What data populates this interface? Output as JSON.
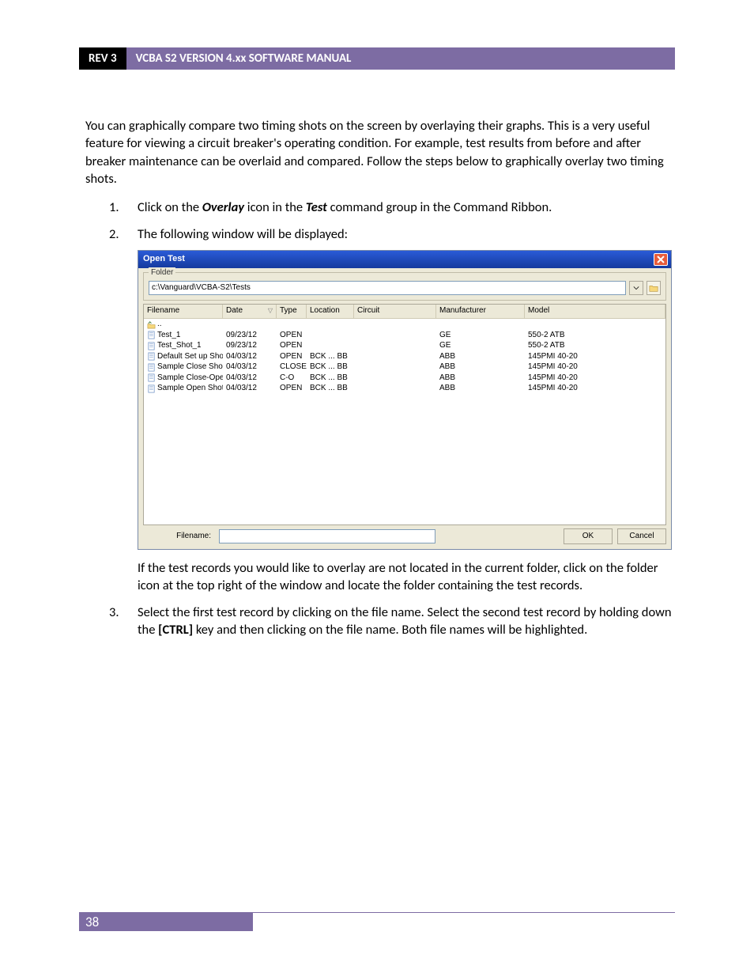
{
  "header": {
    "rev": "REV 3",
    "title": "VCBA S2 VERSION 4.xx SOFTWARE MANUAL"
  },
  "intro": "You can graphically compare two timing shots on the screen by overlaying their graphs. This is a very useful feature for viewing a circuit breaker's operating condition. For example, test results from before and after breaker maintenance can be overlaid and compared. Follow the steps below to graphically overlay two timing shots.",
  "steps": {
    "s1": {
      "num": "1.",
      "pre": "Click on the ",
      "overlay": "Overlay",
      "mid": " icon in the ",
      "test": "Test",
      "post": " command group in the Command Ribbon."
    },
    "s2": {
      "num": "2.",
      "text": "The following window will be displayed:",
      "after": "If the test records you would like to overlay are not located in the current folder, click on the folder icon at the top right of the window and locate the folder containing the test records."
    },
    "s3": {
      "num": "3.",
      "pre": "Select the first test record by clicking on the file name. Select the second test record by holding down the ",
      "ctrl": "[CTRL]",
      "post": " key and then clicking on the file name. Both file names will be highlighted."
    }
  },
  "dialog": {
    "title": "Open Test",
    "folder_label": "Folder",
    "folder_path": "c:\\Vanguard\\VCBA-S2\\Tests",
    "columns": {
      "file": "Filename",
      "date": "Date",
      "type": "Type",
      "location": "Location",
      "circuit": "Circuit",
      "mfr": "Manufacturer",
      "model": "Model"
    },
    "up": "..",
    "rows": [
      {
        "file": "Test_1",
        "date": "09/23/12",
        "type": "OPEN",
        "loc": "",
        "circ": "",
        "mfr": "GE",
        "model": "550-2 ATB"
      },
      {
        "file": "Test_Shot_1",
        "date": "09/23/12",
        "type": "OPEN",
        "loc": "",
        "circ": "",
        "mfr": "GE",
        "model": "550-2 ATB"
      },
      {
        "file": "Default Set up Shot",
        "date": "04/03/12",
        "type": "OPEN",
        "loc": "BCK     ...   BB",
        "circ": "",
        "mfr": "ABB",
        "model": "145PMI 40-20"
      },
      {
        "file": "Sample Close Shot",
        "date": "04/03/12",
        "type": "CLOSE",
        "loc": "BCK     ...   BB",
        "circ": "",
        "mfr": "ABB",
        "model": "145PMI 40-20"
      },
      {
        "file": "Sample Close-Open Shot",
        "date": "04/03/12",
        "type": "C-O",
        "loc": "BCK     ...   BB",
        "circ": "",
        "mfr": "ABB",
        "model": "145PMI 40-20"
      },
      {
        "file": "Sample Open Shot",
        "date": "04/03/12",
        "type": "OPEN",
        "loc": "BCK     ...   BB",
        "circ": "",
        "mfr": "ABB",
        "model": "145PMI 40-20"
      }
    ],
    "filename_label": "Filename:",
    "ok": "OK",
    "cancel": "Cancel"
  },
  "page_number": "38"
}
